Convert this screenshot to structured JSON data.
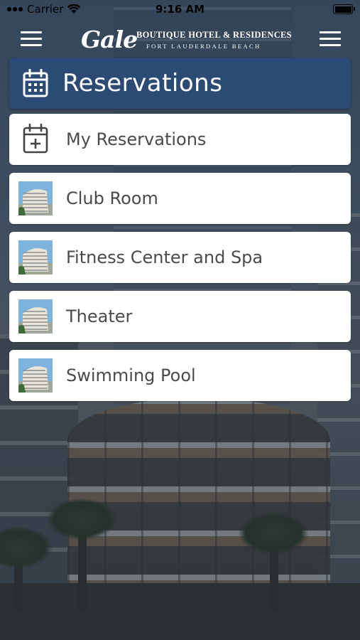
{
  "status_bar": {
    "carrier": "Carrier",
    "time": "9:16 AM",
    "icons": [
      "wifi-icon",
      "battery-icon"
    ]
  },
  "nav": {
    "left_icon": "menu-icon",
    "right_icon": "menu-icon",
    "logo": {
      "script": "Gale",
      "line1": "BOUTIQUE HOTEL & RESIDENCES",
      "line2": "FORT LAUDERDALE BEACH"
    }
  },
  "header": {
    "icon": "calendar-icon",
    "title": "Reservations"
  },
  "items": [
    {
      "label": "My Reservations",
      "icon": "calendar-add-icon"
    },
    {
      "label": "Club Room",
      "icon": "building-thumbnail"
    },
    {
      "label": "Fitness Center and Spa",
      "icon": "building-thumbnail"
    },
    {
      "label": "Theater",
      "icon": "building-thumbnail"
    },
    {
      "label": "Swimming Pool",
      "icon": "building-thumbnail"
    }
  ],
  "colors": {
    "header_bg": "#2b4a74",
    "item_bg": "#ffffff",
    "item_text": "#4a4a4a",
    "nav_icons": "#ffffff"
  }
}
